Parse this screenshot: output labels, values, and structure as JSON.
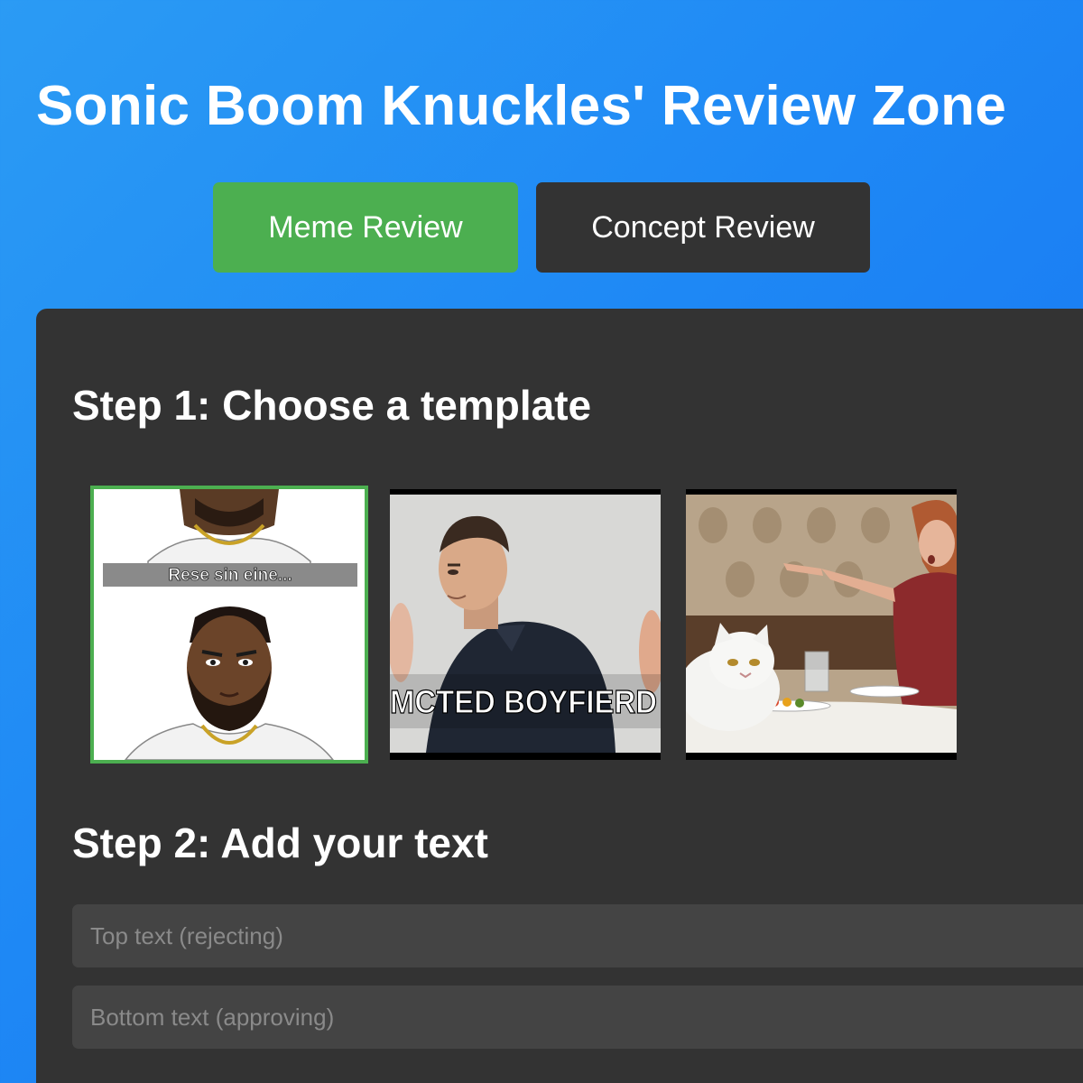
{
  "header": {
    "title": "Sonic Boom Knuckles' Review Zone"
  },
  "tabs": [
    {
      "label": "Meme Review",
      "active": true
    },
    {
      "label": "Concept Review",
      "active": false
    }
  ],
  "step1": {
    "heading": "Step 1: Choose a template",
    "templates": [
      {
        "caption": "Rese sin eine...",
        "selected": true
      },
      {
        "caption": "MCTED BOYFIERD",
        "selected": false
      },
      {
        "caption": "",
        "selected": false
      }
    ]
  },
  "step2": {
    "heading": "Step 2: Add your text",
    "top_placeholder": "Top text (rejecting)",
    "bottom_placeholder": "Bottom text (approving)"
  },
  "colors": {
    "background_gradient_start": "#2b9bf4",
    "background_gradient_end": "#1570f0",
    "active_tab": "#4caf50",
    "inactive_tab": "#333333",
    "panel": "#333333",
    "input_bg": "#444444"
  }
}
